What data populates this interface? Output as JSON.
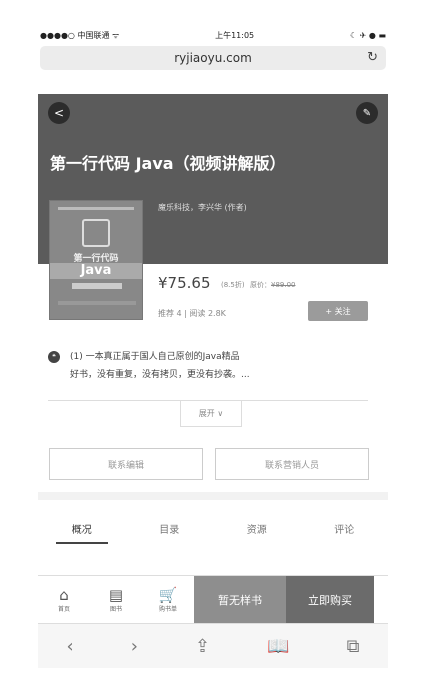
{
  "status": {
    "carrier": "●●●●○ 中国联通 ᯤ",
    "time": "上午11:05",
    "right": "☾ ✈ ● ▬"
  },
  "browser": {
    "url": "ryjiaoyu.com",
    "reload_icon": "↻"
  },
  "book": {
    "title": "第一行代码 Java（视频讲解版）",
    "authors": "魔乐科技，李兴华 (作者)",
    "cover": {
      "line1": "第一行代码",
      "line2": "Java"
    },
    "price": "¥75.65",
    "discount": "(8.5折)",
    "orig_label": "原价：",
    "orig_price": "¥89.00",
    "meta": "推荐 4  |  阅读 2.8K",
    "follow_label": "+ 关注"
  },
  "description": {
    "icon": "❝",
    "line1": "(1) 一本真正属于国人自己原创的Java精品",
    "line2": "好书，没有重复，没有拷贝，更没有抄袭。..."
  },
  "expand_label": "展开 ∨",
  "actions": {
    "contact_editor": "联系编辑",
    "contact_sales": "联系营销人员"
  },
  "tabs": [
    {
      "label": "概况"
    },
    {
      "label": "目录"
    },
    {
      "label": "资源"
    },
    {
      "label": "评论"
    }
  ],
  "bottom_nav": {
    "home": "首页",
    "books": "图书",
    "cart": "购书单",
    "no_sample": "暂无样书",
    "buy_now": "立即购买"
  },
  "safari": {
    "back": "‹",
    "forward": "›",
    "share": "⇪",
    "bookmarks": "📖",
    "tabs": "⧉"
  }
}
